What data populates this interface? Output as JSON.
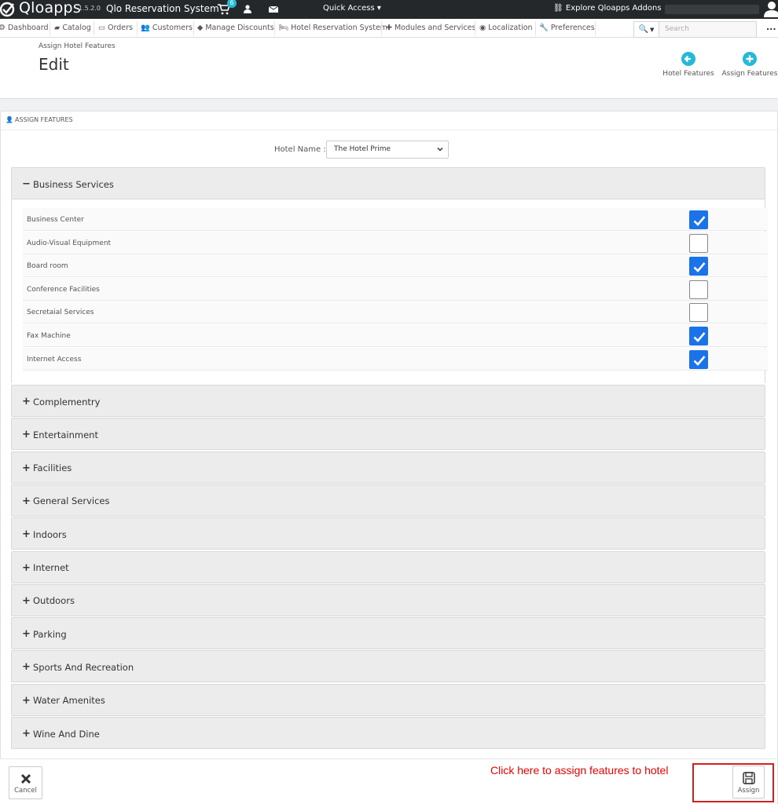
{
  "topbar": {
    "logo": "Qloapps",
    "version": "1.5.2.0",
    "system_name": "Qlo Reservation System",
    "cart_count": "6",
    "quick_access": "Quick Access ▾",
    "explore": "Explore Qloapps Addons"
  },
  "nav": {
    "items": [
      "Dashboard",
      "Catalog",
      "Orders",
      "Customers",
      "Manage Discounts",
      "Hotel Reservation System",
      "Modules and Services",
      "Localization",
      "Preferences"
    ],
    "search_placeholder": "Search",
    "more": "..."
  },
  "header": {
    "breadcrumb": "Assign Hotel Features",
    "title": "Edit",
    "hotel_features_btn": "Hotel Features",
    "assign_features_btn": "Assign Features"
  },
  "panel": {
    "heading": "ASSIGN FEATURES",
    "hotel_label": "Hotel Name :",
    "hotel_selected": "The Hotel Prime",
    "expanded_group": {
      "name": "Business Services",
      "features": [
        {
          "label": "Business Center",
          "checked": true
        },
        {
          "label": "Audio-Visual Equipment",
          "checked": false
        },
        {
          "label": "Board room",
          "checked": true
        },
        {
          "label": "Conference Facilities",
          "checked": false
        },
        {
          "label": "Secretaial Services",
          "checked": false
        },
        {
          "label": "Fax Machine",
          "checked": true
        },
        {
          "label": "Internet Access",
          "checked": true
        }
      ]
    },
    "collapsed_groups": [
      "Complementry",
      "Entertainment",
      "Facilities",
      "General Services",
      "Indoors",
      "Internet",
      "Outdoors",
      "Parking",
      "Sports And Recreation",
      "Water Amenites",
      "Wine And Dine"
    ]
  },
  "footer": {
    "cancel": "Cancel",
    "assign": "Assign",
    "note": "Click here to assign features to hotel"
  },
  "colors": {
    "accent": "#25b9d7",
    "checkbox": "#1a73e8",
    "annotation": "#e00000"
  }
}
